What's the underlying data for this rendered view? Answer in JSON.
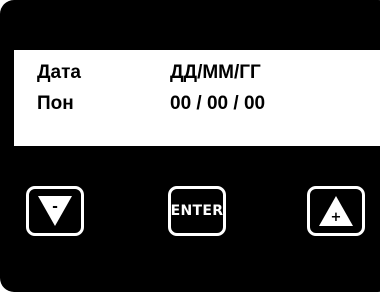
{
  "display": {
    "row1": {
      "label": "Дата",
      "value": "ДД/ММ/ГГ"
    },
    "row2": {
      "label": "Пон",
      "value": "00 / 00 / 00"
    }
  },
  "keys": {
    "down": {
      "icon": "triangle-down-minus-icon",
      "symbol": "-"
    },
    "enter": {
      "label": "ENTER"
    },
    "up": {
      "icon": "triangle-up-plus-icon",
      "symbol": "+"
    }
  },
  "colors": {
    "panel": "#000000",
    "screen": "#ffffff",
    "text": "#000000",
    "key_outline": "#ffffff"
  }
}
